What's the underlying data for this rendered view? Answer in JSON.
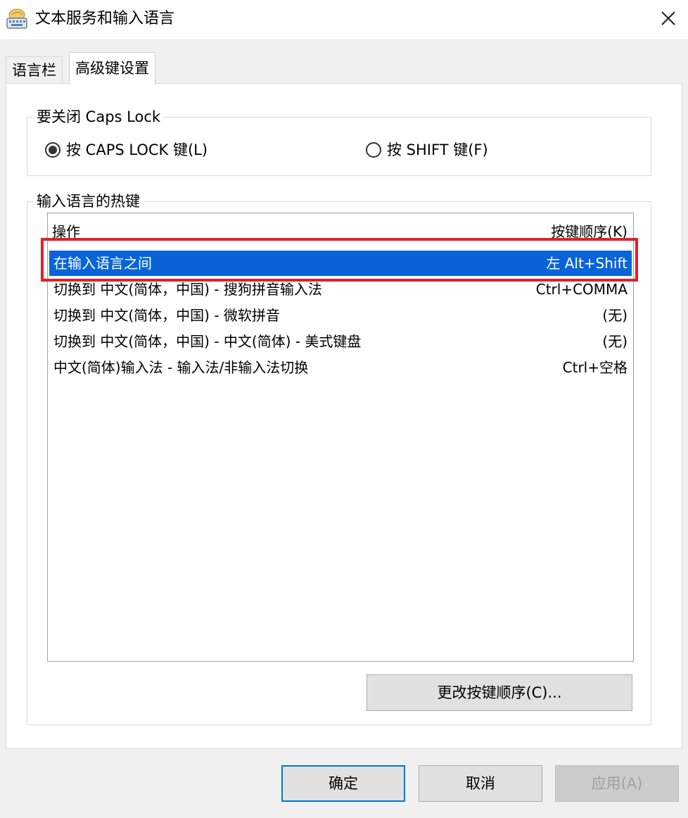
{
  "window": {
    "title": "文本服务和输入语言",
    "close_icon": "close-icon"
  },
  "tabs": [
    {
      "label": "语言栏",
      "active": false
    },
    {
      "label": "高级键设置",
      "active": true
    }
  ],
  "caps_lock_group": {
    "title": "要关闭 Caps Lock",
    "options": [
      {
        "label": "按 CAPS LOCK 键(L)",
        "checked": true
      },
      {
        "label": "按 SHIFT 键(F)",
        "checked": false
      }
    ]
  },
  "hotkeys_group": {
    "title": "输入语言的热键",
    "columns": {
      "action": "操作",
      "keys": "按键顺序(K)"
    },
    "rows": [
      {
        "action": "在输入语言之间",
        "keys": "左 Alt+Shift",
        "selected": true
      },
      {
        "action": "切换到 中文(简体，中国) - 搜狗拼音输入法",
        "keys": "Ctrl+COMMA",
        "selected": false
      },
      {
        "action": "切换到 中文(简体，中国) - 微软拼音",
        "keys": "(无)",
        "selected": false
      },
      {
        "action": "切换到 中文(简体，中国) - 中文(简体) - 美式键盘",
        "keys": "(无)",
        "selected": false
      },
      {
        "action": "中文(简体)输入法 - 输入法/非输入法切换",
        "keys": "Ctrl+空格",
        "selected": false
      }
    ],
    "change_button": "更改按键顺序(C)..."
  },
  "footer": {
    "ok": "确定",
    "cancel": "取消",
    "apply": "应用(A)"
  },
  "colors": {
    "selection": "#0a64d8",
    "annotation_frame": "#e0202a",
    "primary_border": "#0078d7"
  }
}
